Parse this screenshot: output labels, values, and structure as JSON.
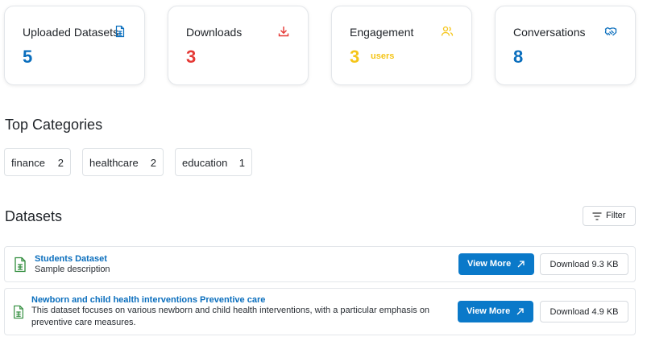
{
  "stats": [
    {
      "label": "Uploaded Datasets",
      "value": "5",
      "unit": "",
      "icon": "file-spreadsheet-icon",
      "color": "#0a6ebd"
    },
    {
      "label": "Downloads",
      "value": "3",
      "unit": "",
      "icon": "download-icon",
      "color": "#e53935"
    },
    {
      "label": "Engagement",
      "value": "3",
      "unit": "users",
      "icon": "users-icon",
      "color": "#f5c518"
    },
    {
      "label": "Conversations",
      "value": "8",
      "unit": "",
      "icon": "handshake-icon",
      "color": "#0a6ebd"
    }
  ],
  "top_categories": {
    "title": "Top Categories",
    "items": [
      {
        "name": "finance",
        "count": "2"
      },
      {
        "name": "healthcare",
        "count": "2"
      },
      {
        "name": "education",
        "count": "1"
      }
    ]
  },
  "datasets": {
    "title": "Datasets",
    "filter_label": "Filter",
    "items": [
      {
        "title": "Students Dataset",
        "description": "Sample description",
        "view_label": "View More",
        "download_label": "Download 9.3 KB"
      },
      {
        "title": "Newborn and child health interventions Preventive care",
        "description": "This dataset focuses on various newborn and child health interventions, with a particular emphasis on preventive care measures.",
        "view_label": "View More",
        "download_label": "Download 4.9 KB"
      }
    ]
  }
}
